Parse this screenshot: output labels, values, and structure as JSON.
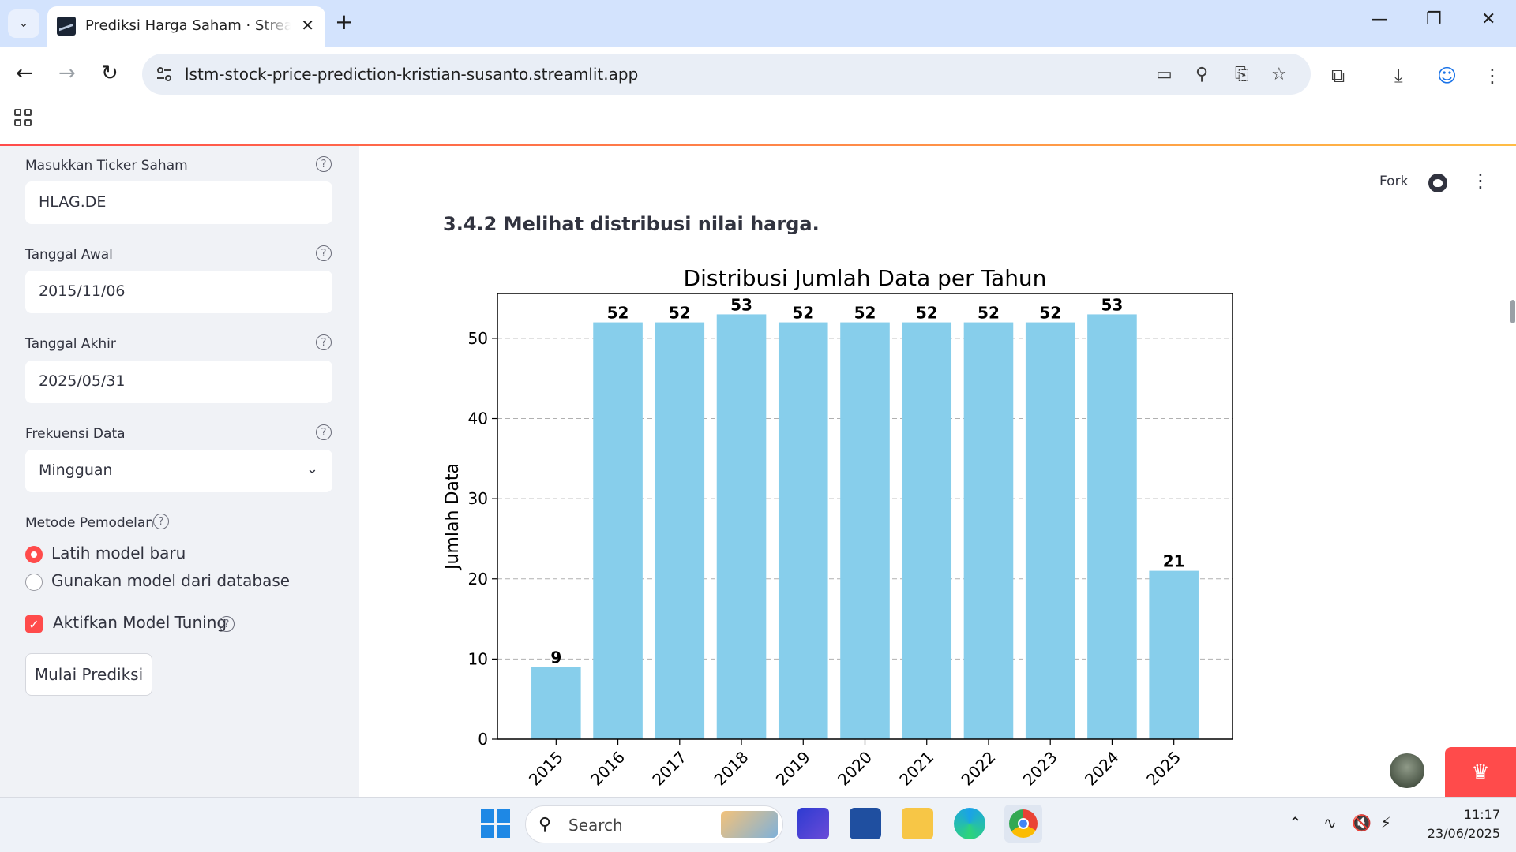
{
  "browser": {
    "tab_title": "Prediksi Harga Saham · Streamlit",
    "url": "lstm-stock-price-prediction-kristian-susanto.streamlit.app"
  },
  "sidebar": {
    "ticker": {
      "label": "Masukkan Ticker Saham",
      "value": "HLAG.DE"
    },
    "start_date": {
      "label": "Tanggal Awal",
      "value": "2015/11/06"
    },
    "end_date": {
      "label": "Tanggal Akhir",
      "value": "2025/05/31"
    },
    "frequency": {
      "label": "Frekuensi Data",
      "value": "Mingguan"
    },
    "method": {
      "label": "Metode Pemodelan",
      "options": [
        "Latih model baru",
        "Gunakan model dari database"
      ],
      "selected": "Latih model baru"
    },
    "tuning": {
      "label": "Aktifkan Model Tuning",
      "checked": true
    },
    "start_button": "Mulai Prediksi"
  },
  "header": {
    "fork_label": "Fork"
  },
  "main": {
    "heading": "3.4.2 Melihat distribusi nilai harga."
  },
  "chart_data": {
    "type": "bar",
    "title": "Distribusi Jumlah Data per Tahun",
    "xlabel": "",
    "ylabel": "Jumlah Data",
    "categories": [
      "2015",
      "2016",
      "2017",
      "2018",
      "2019",
      "2020",
      "2021",
      "2022",
      "2023",
      "2024",
      "2025"
    ],
    "values": [
      9,
      52,
      52,
      53,
      52,
      52,
      52,
      52,
      52,
      53,
      21
    ],
    "ylim": [
      0,
      55.6
    ],
    "yticks": [
      0,
      10,
      20,
      30,
      40,
      50
    ],
    "grid": "y-dashed",
    "bar_color": "#87ceeb"
  },
  "taskbar": {
    "search_placeholder": "Search",
    "time": "11:17",
    "date": "23/06/2025"
  },
  "colors": {
    "accent": "#ff4b4b",
    "tabbar": "#d3e3fd",
    "sidebar": "#f0f2f6"
  }
}
